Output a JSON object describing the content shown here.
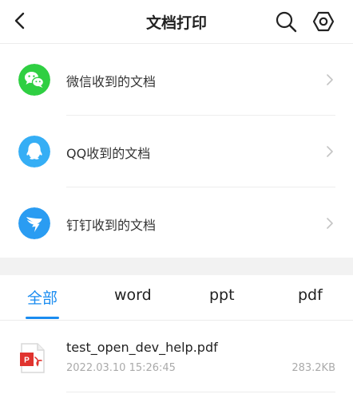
{
  "header": {
    "title": "文档打印",
    "back_icon": "chevron-left-icon",
    "search_icon": "search-icon",
    "settings_icon": "hexagon-settings-icon"
  },
  "sources": [
    {
      "label": "微信收到的文档",
      "icon": "wechat-icon",
      "color": "#2fcf42"
    },
    {
      "label": "QQ收到的文档",
      "icon": "qq-icon",
      "color": "#35aef5"
    },
    {
      "label": "钉钉收到的文档",
      "icon": "dingtalk-icon",
      "color": "#2a9cf2"
    }
  ],
  "tabs": [
    {
      "label": "全部",
      "active": true
    },
    {
      "label": "word",
      "active": false
    },
    {
      "label": "ppt",
      "active": false
    },
    {
      "label": "pdf",
      "active": false
    }
  ],
  "files": [
    {
      "name": "test_open_dev_help.pdf",
      "date": "2022.03.10 15:26:45",
      "size": "283.2KB",
      "icon": "pdf-file-icon"
    }
  ],
  "colors": {
    "accent": "#1a8cf0",
    "pdf_red": "#e0332e"
  }
}
